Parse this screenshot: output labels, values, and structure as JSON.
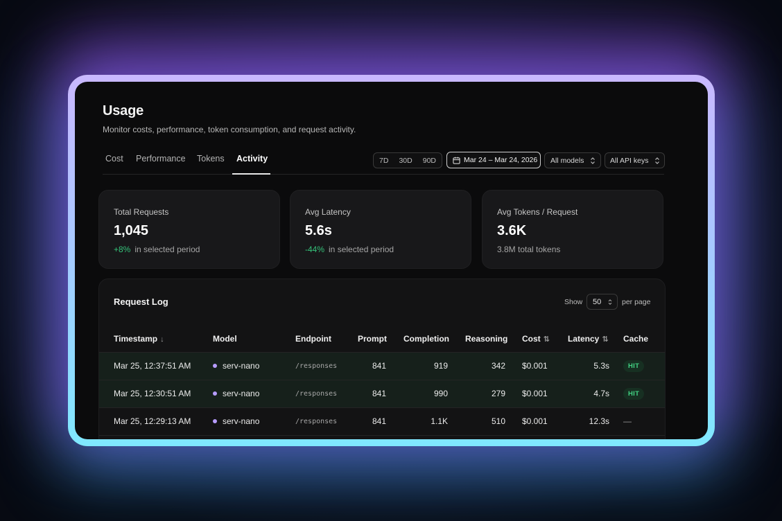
{
  "header": {
    "title": "Usage",
    "subtitle": "Monitor costs, performance, token consumption, and request activity."
  },
  "tabs": [
    {
      "label": "Cost",
      "active": false
    },
    {
      "label": "Performance",
      "active": false
    },
    {
      "label": "Tokens",
      "active": false
    },
    {
      "label": "Activity",
      "active": true
    }
  ],
  "filters": {
    "periods": [
      "7D",
      "30D",
      "90D"
    ],
    "date_range": "Mar 24 – Mar 24, 2026",
    "models": "All models",
    "api_keys": "All API keys"
  },
  "cards": [
    {
      "label": "Total Requests",
      "value": "1,045",
      "delta": "+8%",
      "note": "in selected period"
    },
    {
      "label": "Avg Latency",
      "value": "5.6s",
      "delta": "-44%",
      "note": "in selected period"
    },
    {
      "label": "Avg Tokens / Request",
      "value": "3.6K",
      "note": "3.8M total tokens"
    }
  ],
  "request_log": {
    "title": "Request Log",
    "show_label": "Show",
    "page_size": "50",
    "per_page_label": "per page",
    "columns": [
      "Timestamp",
      "Model",
      "Endpoint",
      "Prompt",
      "Completion",
      "Reasoning",
      "Cost",
      "Latency",
      "Cache"
    ],
    "rows": [
      {
        "timestamp": "Mar 25, 12:37:51 AM",
        "model": "serv-nano",
        "endpoint": "/responses",
        "prompt": "841",
        "completion": "919",
        "reasoning": "342",
        "cost": "$0.001",
        "latency": "5.3s",
        "cache": "HIT"
      },
      {
        "timestamp": "Mar 25, 12:30:51 AM",
        "model": "serv-nano",
        "endpoint": "/responses",
        "prompt": "841",
        "completion": "990",
        "reasoning": "279",
        "cost": "$0.001",
        "latency": "4.7s",
        "cache": "HIT"
      },
      {
        "timestamp": "Mar 25, 12:29:13 AM",
        "model": "serv-nano",
        "endpoint": "/responses",
        "prompt": "841",
        "completion": "1.1K",
        "reasoning": "510",
        "cost": "$0.001",
        "latency": "12.3s",
        "cache": "—"
      }
    ]
  },
  "colors": {
    "accent_positive": "#35c27a",
    "model_dot": "#b79cff",
    "cache_hit": "#42d283"
  }
}
